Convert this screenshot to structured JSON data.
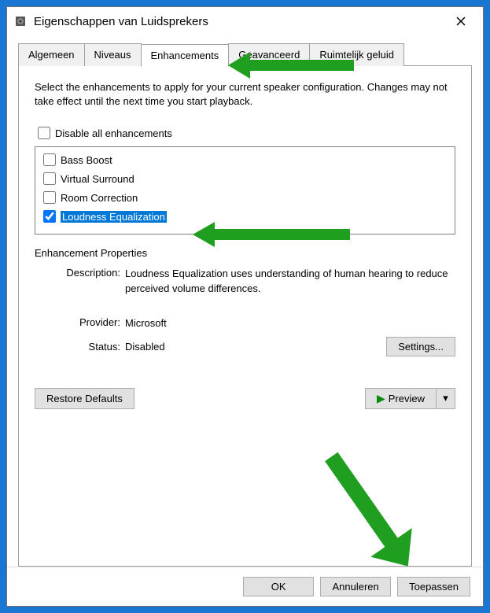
{
  "window": {
    "title": "Eigenschappen van Luidsprekers"
  },
  "tabs": {
    "t0": "Algemeen",
    "t1": "Niveaus",
    "t2": "Enhancements",
    "t3": "Geavanceerd",
    "t4": "Ruimtelijk geluid"
  },
  "panel": {
    "intro": "Select the enhancements to apply for your current speaker configuration. Changes may not take effect until the next time you start playback.",
    "disable_all_label": "Disable all enhancements",
    "items": {
      "bass": "Bass Boost",
      "vs": "Virtual Surround",
      "rc": "Room Correction",
      "le": "Loudness Equalization"
    },
    "props_heading": "Enhancement Properties",
    "desc_label": "Description:",
    "desc_value": "Loudness Equalization uses understanding of human hearing to reduce perceived volume differences.",
    "provider_label": "Provider:",
    "provider_value": "Microsoft",
    "status_label": "Status:",
    "status_value": "Disabled",
    "settings_btn": "Settings...",
    "restore_btn": "Restore Defaults",
    "preview_btn": "Preview"
  },
  "buttons": {
    "ok": "OK",
    "cancel": "Annuleren",
    "apply": "Toepassen"
  }
}
